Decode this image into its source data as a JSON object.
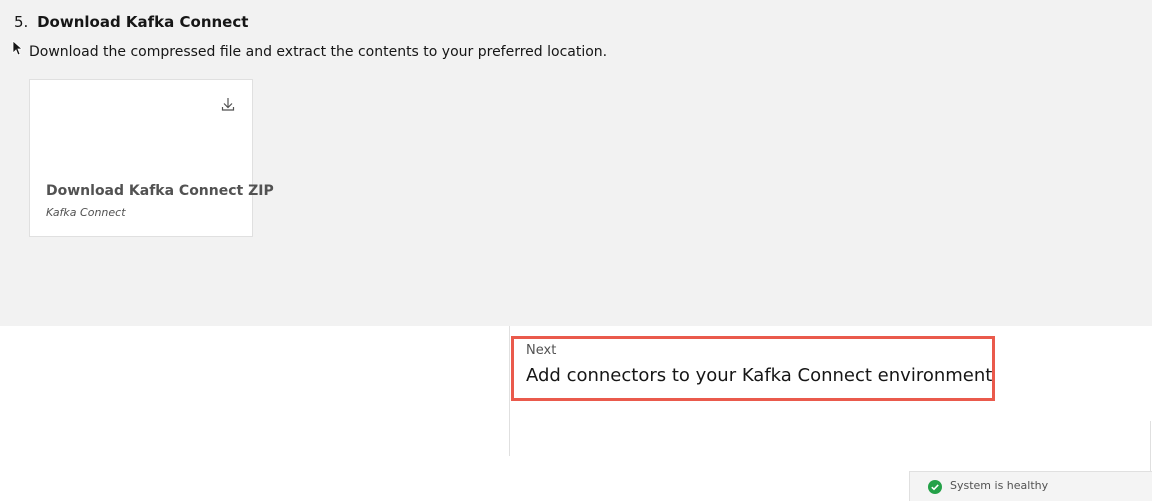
{
  "step": {
    "number": "5.",
    "title": "Download Kafka Connect",
    "description": "Download the compressed file and extract the contents to your preferred location."
  },
  "download_tile": {
    "title": "Download Kafka Connect ZIP",
    "subtitle": "Kafka Connect",
    "icon": "download-icon"
  },
  "next": {
    "label": "Next",
    "title": "Add connectors to your Kafka Connect environment",
    "highlight_color": "#ea5a4c"
  },
  "status": {
    "text": "System is healthy",
    "icon": "checkmark-filled-icon",
    "color": "#24a148"
  }
}
